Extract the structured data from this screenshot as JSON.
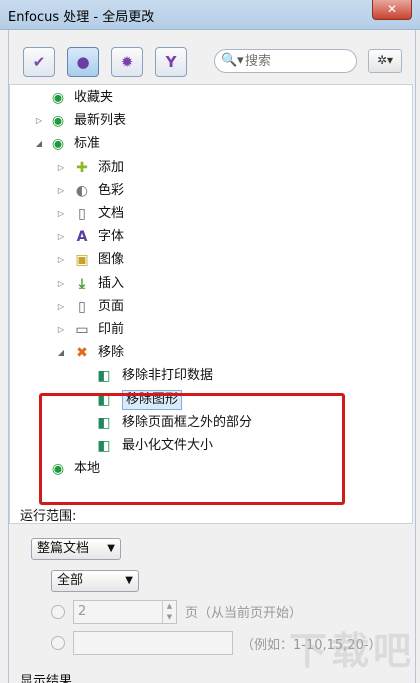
{
  "window": {
    "title": "Enfocus 处理 - 全局更改",
    "close_label": "✕"
  },
  "toolbar": {
    "buttons": [
      {
        "icon": "check-icon",
        "glyph": "✔",
        "color": "#7b4aa8"
      },
      {
        "icon": "globe-icon",
        "glyph": "●",
        "color": "#6a3fa0",
        "active": true
      },
      {
        "icon": "gear-icon",
        "glyph": "✹",
        "color": "#7b3fa8"
      },
      {
        "icon": "filter-icon",
        "glyph": "Y",
        "color": "#7b3fa8"
      }
    ],
    "search_placeholder": "搜索",
    "search_icon_text": "🔍▾",
    "gear_menu_text": "✲▾"
  },
  "tree": [
    {
      "label": "收藏夹",
      "icon": "globe-folder-icon",
      "indent": 0,
      "twisty": ""
    },
    {
      "label": "最新列表",
      "icon": "globe-folder-icon",
      "indent": 0,
      "twisty": "▷"
    },
    {
      "label": "标准",
      "icon": "globe-folder-icon",
      "indent": 0,
      "twisty": "◢"
    },
    {
      "label": "添加",
      "icon": "plus-icon",
      "indent": 1,
      "twisty": "▷"
    },
    {
      "label": "色彩",
      "icon": "palette-icon",
      "indent": 1,
      "twisty": "▷"
    },
    {
      "label": "文档",
      "icon": "document-icon",
      "indent": 1,
      "twisty": "▷"
    },
    {
      "label": "字体",
      "icon": "font-icon",
      "indent": 1,
      "twisty": "▷"
    },
    {
      "label": "图像",
      "icon": "image-icon",
      "indent": 1,
      "twisty": "▷"
    },
    {
      "label": "插入",
      "icon": "insert-icon",
      "indent": 1,
      "twisty": "▷"
    },
    {
      "label": "页面",
      "icon": "page-icon",
      "indent": 1,
      "twisty": "▷"
    },
    {
      "label": "印前",
      "icon": "monitor-icon",
      "indent": 1,
      "twisty": "▷"
    },
    {
      "label": "移除",
      "icon": "remove-x-icon",
      "indent": 1,
      "twisty": "◢"
    },
    {
      "label": "移除非打印数据",
      "icon": "action-doc-icon",
      "indent": 2,
      "twisty": ""
    },
    {
      "label": "移除图形",
      "icon": "action-doc-icon",
      "indent": 2,
      "twisty": "",
      "selected": true
    },
    {
      "label": "移除页面框之外的部分",
      "icon": "action-doc-icon",
      "indent": 2,
      "twisty": ""
    },
    {
      "label": "最小化文件大小",
      "icon": "action-doc-icon",
      "indent": 2,
      "twisty": ""
    },
    {
      "label": "本地",
      "icon": "globe-folder-icon",
      "indent": 0,
      "twisty": ""
    }
  ],
  "run_scope": {
    "label": "运行范围:",
    "scope_select": "整篇文档",
    "pages_select": "全部",
    "page_value": "2",
    "page_suffix": "页（从当前页开始）",
    "range_hint": "（例如：1-10,15,20-）"
  },
  "results_label": "显示结果",
  "watermark": "下载吧",
  "colors": {
    "highlight_box": "#d21a1a",
    "selection": "#d9ebfb"
  }
}
